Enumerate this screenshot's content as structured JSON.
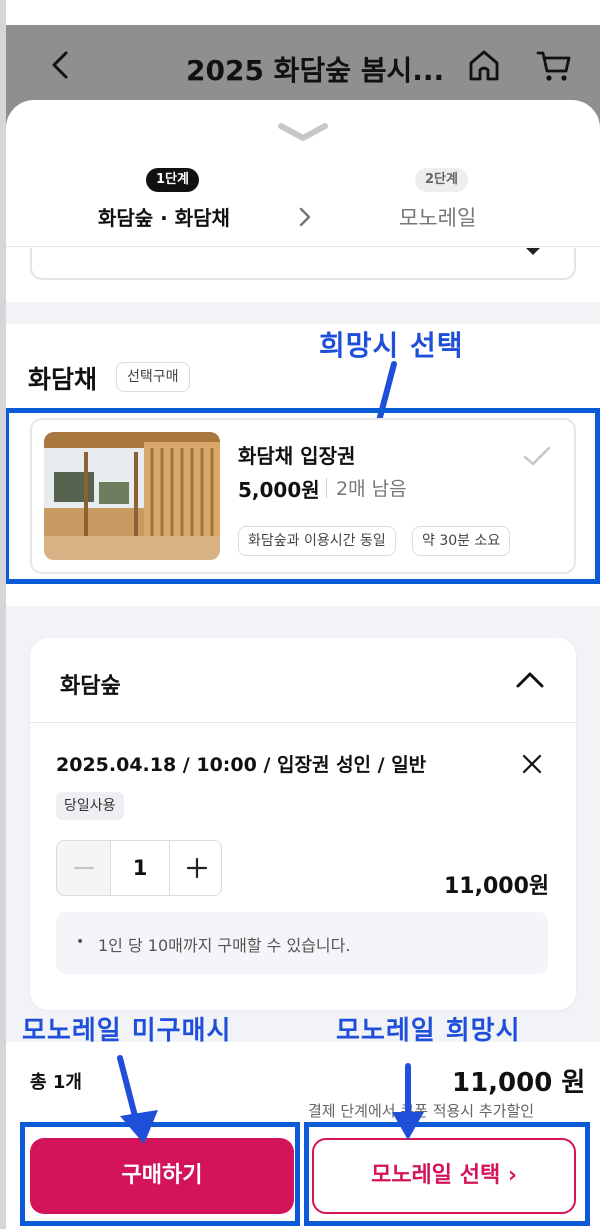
{
  "header": {
    "title": "2025 화담숲 봄시...",
    "back_icon": "chevron-left-icon",
    "home_icon": "home-icon",
    "cart_icon": "cart-icon"
  },
  "steps": {
    "step1_badge": "1단계",
    "step1_label": "화담숲 · 화담채",
    "step2_badge": "2단계",
    "step2_label": "모노레일"
  },
  "hwadamchae": {
    "title": "화담채",
    "tag": "선택구매",
    "card": {
      "name": "화담채 입장권",
      "price": "5,000원",
      "remaining": "2매 남음",
      "chips": [
        "화담숲과 이용시간 동일",
        "약 30분 소요"
      ]
    }
  },
  "annotations": {
    "optional_select": "희망시 선택",
    "no_monorail": "모노레일 미구매시",
    "want_monorail": "모노레일 희망시"
  },
  "order": {
    "section_title": "화담숲",
    "item_title": "2025.04.18 / 10:00 / 입장권 성인 / 일반",
    "badge": "당일사용",
    "quantity": "1",
    "item_price": "11,000원",
    "note": "1인 당 10매까지 구매할 수 있습니다."
  },
  "footer": {
    "total_label": "총 1개",
    "total_price": "11,000 원",
    "total_note": "결제 단계에서 쿠폰 적용시 추가할인",
    "buy_label": "구매하기",
    "monorail_label": "모노레일 선택 ›"
  },
  "colors": {
    "accent": "#d4145a",
    "annotation_blue": "#0b5bd9"
  }
}
